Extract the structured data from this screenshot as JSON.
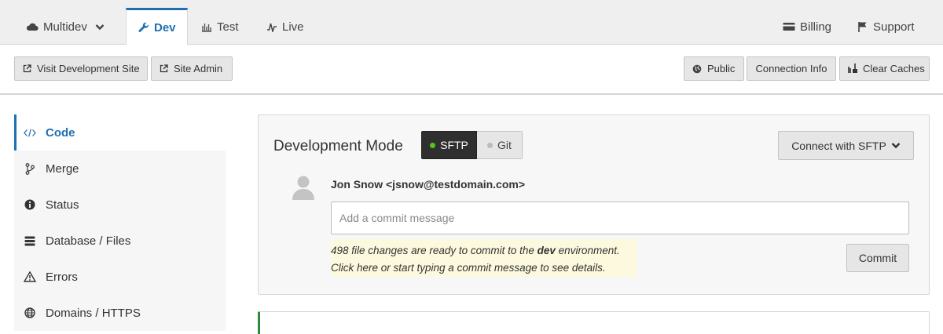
{
  "topnav": {
    "tabs": [
      {
        "label": "Multidev",
        "icon": "cloud-icon"
      },
      {
        "label": "Dev",
        "icon": "wrench-icon"
      },
      {
        "label": "Test",
        "icon": "bar-chart-icon"
      },
      {
        "label": "Live",
        "icon": "pulse-icon"
      }
    ],
    "right": [
      {
        "label": "Billing",
        "icon": "credit-card-icon"
      },
      {
        "label": "Support",
        "icon": "flag-icon"
      }
    ],
    "active_color": "#1f6fb2"
  },
  "toolbar": {
    "visit_label": "Visit Development Site",
    "admin_label": "Site Admin",
    "public_label": "Public",
    "connection_label": "Connection Info",
    "clear_label": "Clear Caches"
  },
  "sidebar": {
    "items": [
      {
        "label": "Code",
        "icon": "code-icon"
      },
      {
        "label": "Merge",
        "icon": "branch-icon"
      },
      {
        "label": "Status",
        "icon": "info-icon"
      },
      {
        "label": "Database / Files",
        "icon": "database-icon"
      },
      {
        "label": "Errors",
        "icon": "warning-icon"
      },
      {
        "label": "Domains / HTTPS",
        "icon": "globe-icon"
      }
    ]
  },
  "dev_mode": {
    "title": "Development Mode",
    "sftp_label": "SFTP",
    "git_label": "Git",
    "connect_label": "Connect with SFTP",
    "user": "Jon Snow <jsnow@testdomain.com>",
    "commit_placeholder": "Add a commit message",
    "notice_pre": "498 file changes are ready to commit to the ",
    "notice_env": "dev",
    "notice_post": " environment.",
    "notice_line2": "Click here or start typing a commit message to see details.",
    "commit_label": "Commit"
  }
}
